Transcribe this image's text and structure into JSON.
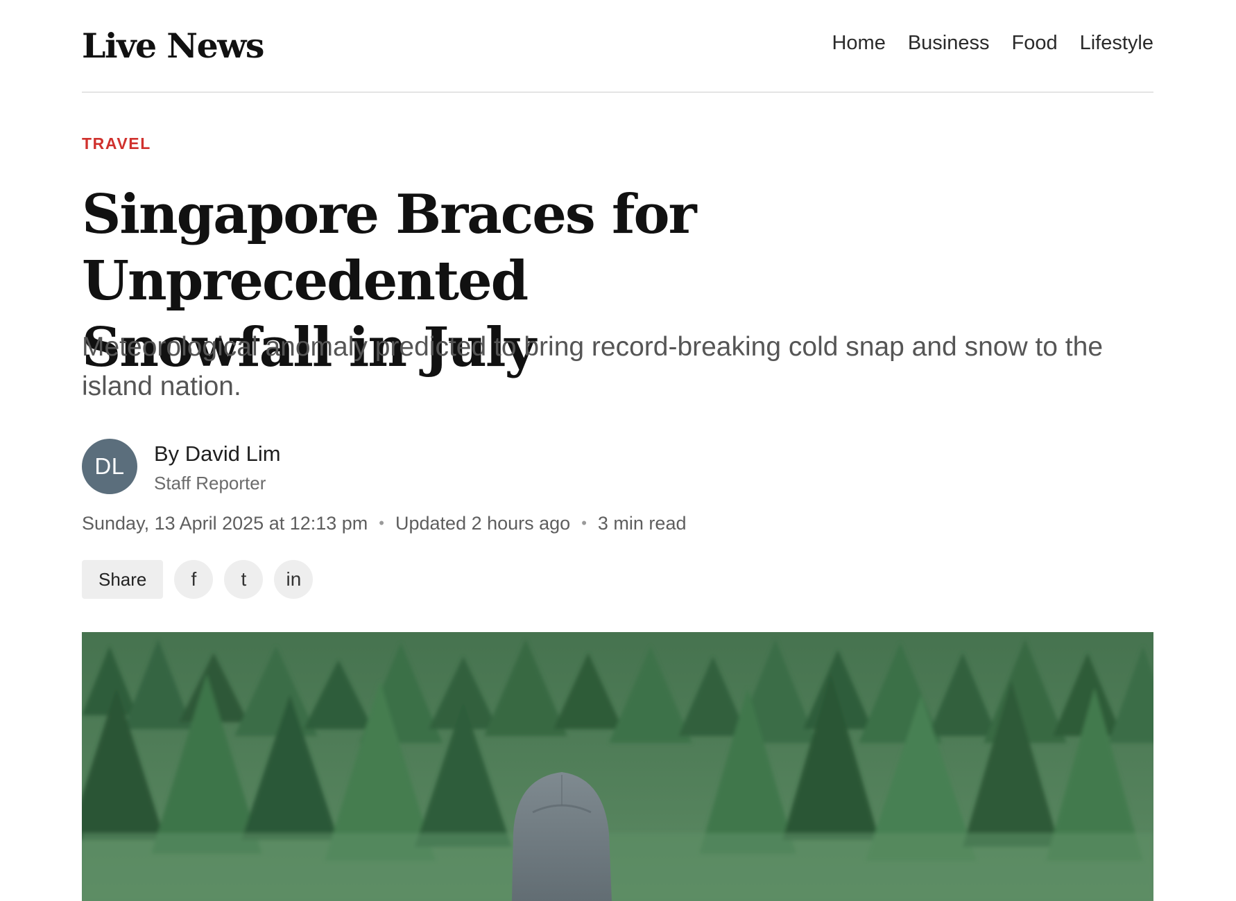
{
  "header": {
    "logo": "Live News",
    "nav": [
      "Home",
      "Business",
      "Food",
      "Lifestyle"
    ]
  },
  "article": {
    "category": "TRAVEL",
    "headline_line1": "Singapore Braces for Unprecedented",
    "headline_line2": "Snowfall in July",
    "subheadline": "Meteorological anomaly predicted to bring record-breaking cold snap and snow to the island nation.",
    "author": {
      "initials": "DL",
      "name": "By David Lim",
      "role": "Staff Reporter"
    },
    "meta": {
      "published": "Sunday, 13 April 2025 at 12:13 pm",
      "updated": "Updated 2 hours ago",
      "read_time": "3 min read",
      "separator": "•"
    },
    "share": {
      "label": "Share",
      "facebook": "f",
      "twitter": "t",
      "linkedin": "in"
    }
  },
  "colors": {
    "accent": "#d0312d",
    "avatar_bg": "#5b6e7c",
    "text": "#111111",
    "muted": "#5e5e5e"
  },
  "hero_image": {
    "description_icon": "forest-hooded-person-image"
  }
}
